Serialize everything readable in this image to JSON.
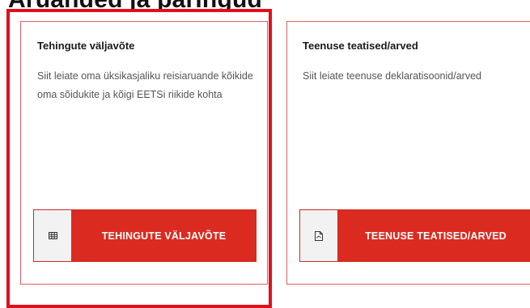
{
  "heading": {
    "text": "Aruanded ja päringud"
  },
  "cards": [
    {
      "title": "Tehingute väljavõte",
      "description": "Siit leiate oma üksikasjaliku reisiaruande kõikide oma sõidukite ja kõigi EETSi riikide kohta",
      "button_label": "TEHINGUTE VÄLJAVÕTE",
      "button_icon": "table-icon"
    },
    {
      "title": "Teenuse teatised/arved",
      "description": "Siit leiate teenuse deklaratisoonid/arved",
      "button_label": "TEENUSE TEATISED/ARVED",
      "button_icon": "pdf-document-icon"
    }
  ],
  "colors": {
    "accent": "#db2b20",
    "highlight_border": "#e0101b",
    "card_border": "#e06060"
  }
}
